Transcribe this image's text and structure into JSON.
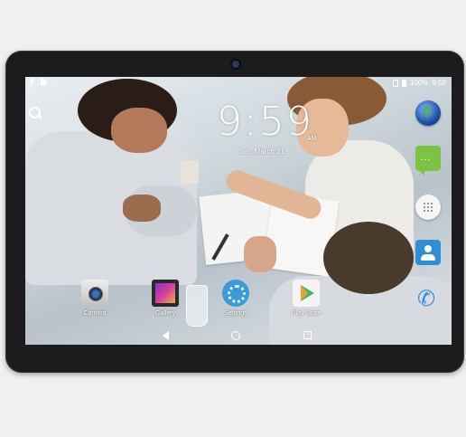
{
  "status_bar": {
    "battery": "100%",
    "time": "9:59"
  },
  "lock_clock": {
    "time": "9:59",
    "date": "Sat, March 31",
    "ampm": "AM"
  },
  "dock": {
    "items": [
      {
        "label": "Camera"
      },
      {
        "label": "Gallery"
      },
      {
        "label": "Settings"
      },
      {
        "label": "Play Store"
      }
    ]
  },
  "colors": {
    "bezel": "#1c1c1e",
    "messaging": "#7ec242",
    "contacts": "#2f8ed7",
    "phone": "#2d8ee6",
    "settings": "#3a9bd8",
    "play_store_green": "#3fb66f"
  },
  "icons": {
    "right_dock": [
      "browser-globe-icon",
      "messaging-icon",
      "app-drawer-icon",
      "contacts-icon",
      "phone-icon"
    ],
    "navigation": [
      "back-icon",
      "home-icon",
      "recents-icon"
    ]
  }
}
